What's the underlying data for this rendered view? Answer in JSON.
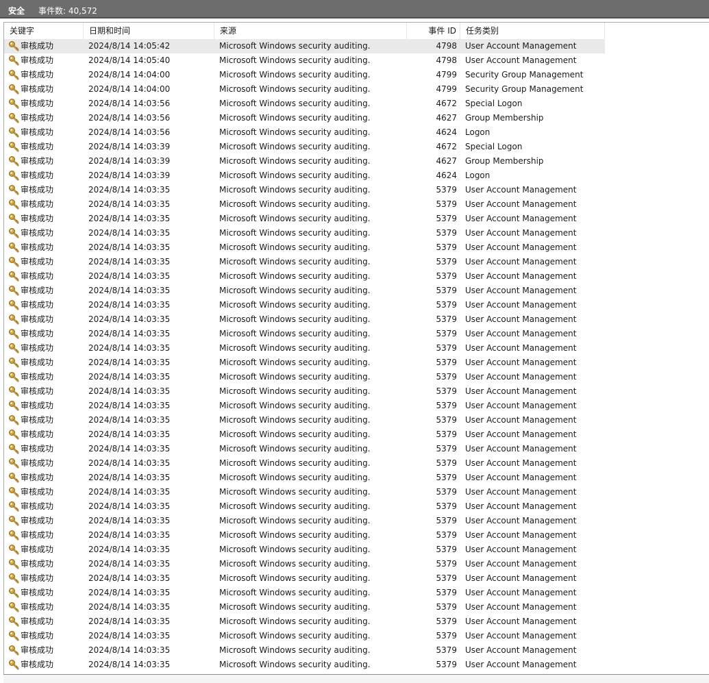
{
  "header": {
    "log_name": "安全",
    "event_count": "事件数: 40,572"
  },
  "columns": {
    "keyword": "关键字",
    "date": "日期和时间",
    "source": "来源",
    "event_id": "事件 ID",
    "task": "任务类别"
  },
  "icons": {
    "row_icon": "key-icon",
    "key_color": "#d9a53a"
  },
  "rows": [
    {
      "keyword": "审核成功",
      "date": "2024/8/14 14:05:42",
      "source": "Microsoft Windows security auditing.",
      "event_id": "4798",
      "task": "User Account Management"
    },
    {
      "keyword": "审核成功",
      "date": "2024/8/14 14:05:40",
      "source": "Microsoft Windows security auditing.",
      "event_id": "4798",
      "task": "User Account Management"
    },
    {
      "keyword": "审核成功",
      "date": "2024/8/14 14:04:00",
      "source": "Microsoft Windows security auditing.",
      "event_id": "4799",
      "task": "Security Group Management"
    },
    {
      "keyword": "审核成功",
      "date": "2024/8/14 14:04:00",
      "source": "Microsoft Windows security auditing.",
      "event_id": "4799",
      "task": "Security Group Management"
    },
    {
      "keyword": "审核成功",
      "date": "2024/8/14 14:03:56",
      "source": "Microsoft Windows security auditing.",
      "event_id": "4672",
      "task": "Special Logon"
    },
    {
      "keyword": "审核成功",
      "date": "2024/8/14 14:03:56",
      "source": "Microsoft Windows security auditing.",
      "event_id": "4627",
      "task": "Group Membership"
    },
    {
      "keyword": "审核成功",
      "date": "2024/8/14 14:03:56",
      "source": "Microsoft Windows security auditing.",
      "event_id": "4624",
      "task": "Logon"
    },
    {
      "keyword": "审核成功",
      "date": "2024/8/14 14:03:39",
      "source": "Microsoft Windows security auditing.",
      "event_id": "4672",
      "task": "Special Logon"
    },
    {
      "keyword": "审核成功",
      "date": "2024/8/14 14:03:39",
      "source": "Microsoft Windows security auditing.",
      "event_id": "4627",
      "task": "Group Membership"
    },
    {
      "keyword": "审核成功",
      "date": "2024/8/14 14:03:39",
      "source": "Microsoft Windows security auditing.",
      "event_id": "4624",
      "task": "Logon"
    },
    {
      "keyword": "审核成功",
      "date": "2024/8/14 14:03:35",
      "source": "Microsoft Windows security auditing.",
      "event_id": "5379",
      "task": "User Account Management"
    },
    {
      "keyword": "审核成功",
      "date": "2024/8/14 14:03:35",
      "source": "Microsoft Windows security auditing.",
      "event_id": "5379",
      "task": "User Account Management"
    },
    {
      "keyword": "审核成功",
      "date": "2024/8/14 14:03:35",
      "source": "Microsoft Windows security auditing.",
      "event_id": "5379",
      "task": "User Account Management"
    },
    {
      "keyword": "审核成功",
      "date": "2024/8/14 14:03:35",
      "source": "Microsoft Windows security auditing.",
      "event_id": "5379",
      "task": "User Account Management"
    },
    {
      "keyword": "审核成功",
      "date": "2024/8/14 14:03:35",
      "source": "Microsoft Windows security auditing.",
      "event_id": "5379",
      "task": "User Account Management"
    },
    {
      "keyword": "审核成功",
      "date": "2024/8/14 14:03:35",
      "source": "Microsoft Windows security auditing.",
      "event_id": "5379",
      "task": "User Account Management"
    },
    {
      "keyword": "审核成功",
      "date": "2024/8/14 14:03:35",
      "source": "Microsoft Windows security auditing.",
      "event_id": "5379",
      "task": "User Account Management"
    },
    {
      "keyword": "审核成功",
      "date": "2024/8/14 14:03:35",
      "source": "Microsoft Windows security auditing.",
      "event_id": "5379",
      "task": "User Account Management"
    },
    {
      "keyword": "审核成功",
      "date": "2024/8/14 14:03:35",
      "source": "Microsoft Windows security auditing.",
      "event_id": "5379",
      "task": "User Account Management"
    },
    {
      "keyword": "审核成功",
      "date": "2024/8/14 14:03:35",
      "source": "Microsoft Windows security auditing.",
      "event_id": "5379",
      "task": "User Account Management"
    },
    {
      "keyword": "审核成功",
      "date": "2024/8/14 14:03:35",
      "source": "Microsoft Windows security auditing.",
      "event_id": "5379",
      "task": "User Account Management"
    },
    {
      "keyword": "审核成功",
      "date": "2024/8/14 14:03:35",
      "source": "Microsoft Windows security auditing.",
      "event_id": "5379",
      "task": "User Account Management"
    },
    {
      "keyword": "审核成功",
      "date": "2024/8/14 14:03:35",
      "source": "Microsoft Windows security auditing.",
      "event_id": "5379",
      "task": "User Account Management"
    },
    {
      "keyword": "审核成功",
      "date": "2024/8/14 14:03:35",
      "source": "Microsoft Windows security auditing.",
      "event_id": "5379",
      "task": "User Account Management"
    },
    {
      "keyword": "审核成功",
      "date": "2024/8/14 14:03:35",
      "source": "Microsoft Windows security auditing.",
      "event_id": "5379",
      "task": "User Account Management"
    },
    {
      "keyword": "审核成功",
      "date": "2024/8/14 14:03:35",
      "source": "Microsoft Windows security auditing.",
      "event_id": "5379",
      "task": "User Account Management"
    },
    {
      "keyword": "审核成功",
      "date": "2024/8/14 14:03:35",
      "source": "Microsoft Windows security auditing.",
      "event_id": "5379",
      "task": "User Account Management"
    },
    {
      "keyword": "审核成功",
      "date": "2024/8/14 14:03:35",
      "source": "Microsoft Windows security auditing.",
      "event_id": "5379",
      "task": "User Account Management"
    },
    {
      "keyword": "审核成功",
      "date": "2024/8/14 14:03:35",
      "source": "Microsoft Windows security auditing.",
      "event_id": "5379",
      "task": "User Account Management"
    },
    {
      "keyword": "审核成功",
      "date": "2024/8/14 14:03:35",
      "source": "Microsoft Windows security auditing.",
      "event_id": "5379",
      "task": "User Account Management"
    },
    {
      "keyword": "审核成功",
      "date": "2024/8/14 14:03:35",
      "source": "Microsoft Windows security auditing.",
      "event_id": "5379",
      "task": "User Account Management"
    },
    {
      "keyword": "审核成功",
      "date": "2024/8/14 14:03:35",
      "source": "Microsoft Windows security auditing.",
      "event_id": "5379",
      "task": "User Account Management"
    },
    {
      "keyword": "审核成功",
      "date": "2024/8/14 14:03:35",
      "source": "Microsoft Windows security auditing.",
      "event_id": "5379",
      "task": "User Account Management"
    },
    {
      "keyword": "审核成功",
      "date": "2024/8/14 14:03:35",
      "source": "Microsoft Windows security auditing.",
      "event_id": "5379",
      "task": "User Account Management"
    },
    {
      "keyword": "审核成功",
      "date": "2024/8/14 14:03:35",
      "source": "Microsoft Windows security auditing.",
      "event_id": "5379",
      "task": "User Account Management"
    },
    {
      "keyword": "审核成功",
      "date": "2024/8/14 14:03:35",
      "source": "Microsoft Windows security auditing.",
      "event_id": "5379",
      "task": "User Account Management"
    },
    {
      "keyword": "审核成功",
      "date": "2024/8/14 14:03:35",
      "source": "Microsoft Windows security auditing.",
      "event_id": "5379",
      "task": "User Account Management"
    },
    {
      "keyword": "审核成功",
      "date": "2024/8/14 14:03:35",
      "source": "Microsoft Windows security auditing.",
      "event_id": "5379",
      "task": "User Account Management"
    },
    {
      "keyword": "审核成功",
      "date": "2024/8/14 14:03:35",
      "source": "Microsoft Windows security auditing.",
      "event_id": "5379",
      "task": "User Account Management"
    },
    {
      "keyword": "审核成功",
      "date": "2024/8/14 14:03:35",
      "source": "Microsoft Windows security auditing.",
      "event_id": "5379",
      "task": "User Account Management"
    },
    {
      "keyword": "审核成功",
      "date": "2024/8/14 14:03:35",
      "source": "Microsoft Windows security auditing.",
      "event_id": "5379",
      "task": "User Account Management"
    },
    {
      "keyword": "审核成功",
      "date": "2024/8/14 14:03:35",
      "source": "Microsoft Windows security auditing.",
      "event_id": "5379",
      "task": "User Account Management"
    },
    {
      "keyword": "审核成功",
      "date": "2024/8/14 14:03:35",
      "source": "Microsoft Windows security auditing.",
      "event_id": "5379",
      "task": "User Account Management"
    },
    {
      "keyword": "审核成功",
      "date": "2024/8/14 14:03:35",
      "source": "Microsoft Windows security auditing.",
      "event_id": "5379",
      "task": "User Account Management"
    }
  ]
}
